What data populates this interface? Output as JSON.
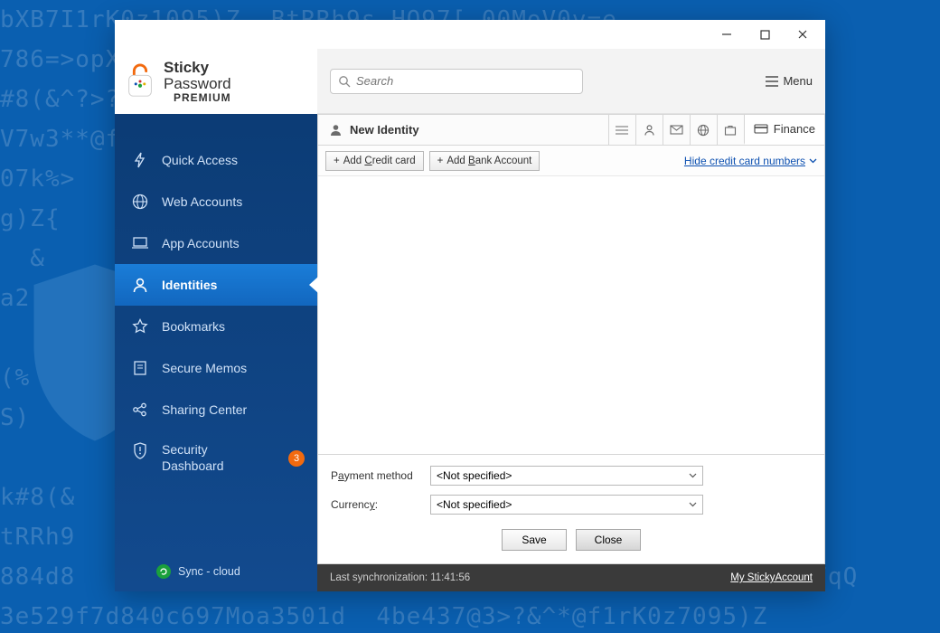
{
  "logo": {
    "line1": "Sticky",
    "line2": "Password",
    "line3": "PREMIUM"
  },
  "search": {
    "placeholder": "Search"
  },
  "menu_label": "Menu",
  "sidebar": {
    "items": [
      {
        "label": "Quick Access"
      },
      {
        "label": "Web Accounts"
      },
      {
        "label": "App Accounts"
      },
      {
        "label": "Identities"
      },
      {
        "label": "Bookmarks"
      },
      {
        "label": "Secure Memos"
      },
      {
        "label": "Sharing Center"
      },
      {
        "label": "Security\nDashboard",
        "badge": "3"
      }
    ],
    "sync_label": "Sync - cloud"
  },
  "identity": {
    "title": "New Identity",
    "finance_tab": "Finance"
  },
  "toolbar": {
    "add_credit_prefix": "Add ",
    "add_credit_hot": "C",
    "add_credit_rest": "redit card",
    "add_bank_prefix": "Add ",
    "add_bank_hot": "B",
    "add_bank_rest": "ank Account",
    "hide_prefix": "H",
    "hide_hot": "i",
    "hide_rest": "de credit card numbers"
  },
  "form": {
    "payment_label_pre": "P",
    "payment_label_hot": "a",
    "payment_label_post": "yment method",
    "currency_label_pre": "Currenc",
    "currency_label_hot": "y",
    "currency_label_post": ":",
    "not_specified": "<Not specified>",
    "save": "Save",
    "close": "Close"
  },
  "status": {
    "left": "Last synchronization: 11:41:56",
    "right": "My StickyAccount"
  }
}
